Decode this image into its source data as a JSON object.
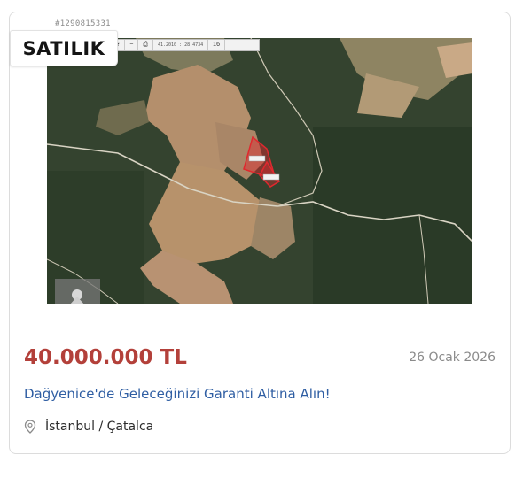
{
  "listing": {
    "id": "#1290815331",
    "badge": "SATILIK",
    "price": "40.000.000 TL",
    "date": "26 Ocak 2026",
    "title": "Dağyenice'de Geleceğinizi Garanti Altına Alın!",
    "location": "İstanbul / Çatalca"
  },
  "map": {
    "toolbar": {
      "star": "★",
      "minus": "−",
      "print": "⎙",
      "coords": "41.2010 : 28.4734",
      "zoom": "16"
    },
    "icons": [
      "star-icon",
      "minus-icon",
      "print-icon"
    ]
  },
  "colors": {
    "price": "#b3403a",
    "title_link": "#2f5ea3",
    "parcel": "#e0282e"
  }
}
